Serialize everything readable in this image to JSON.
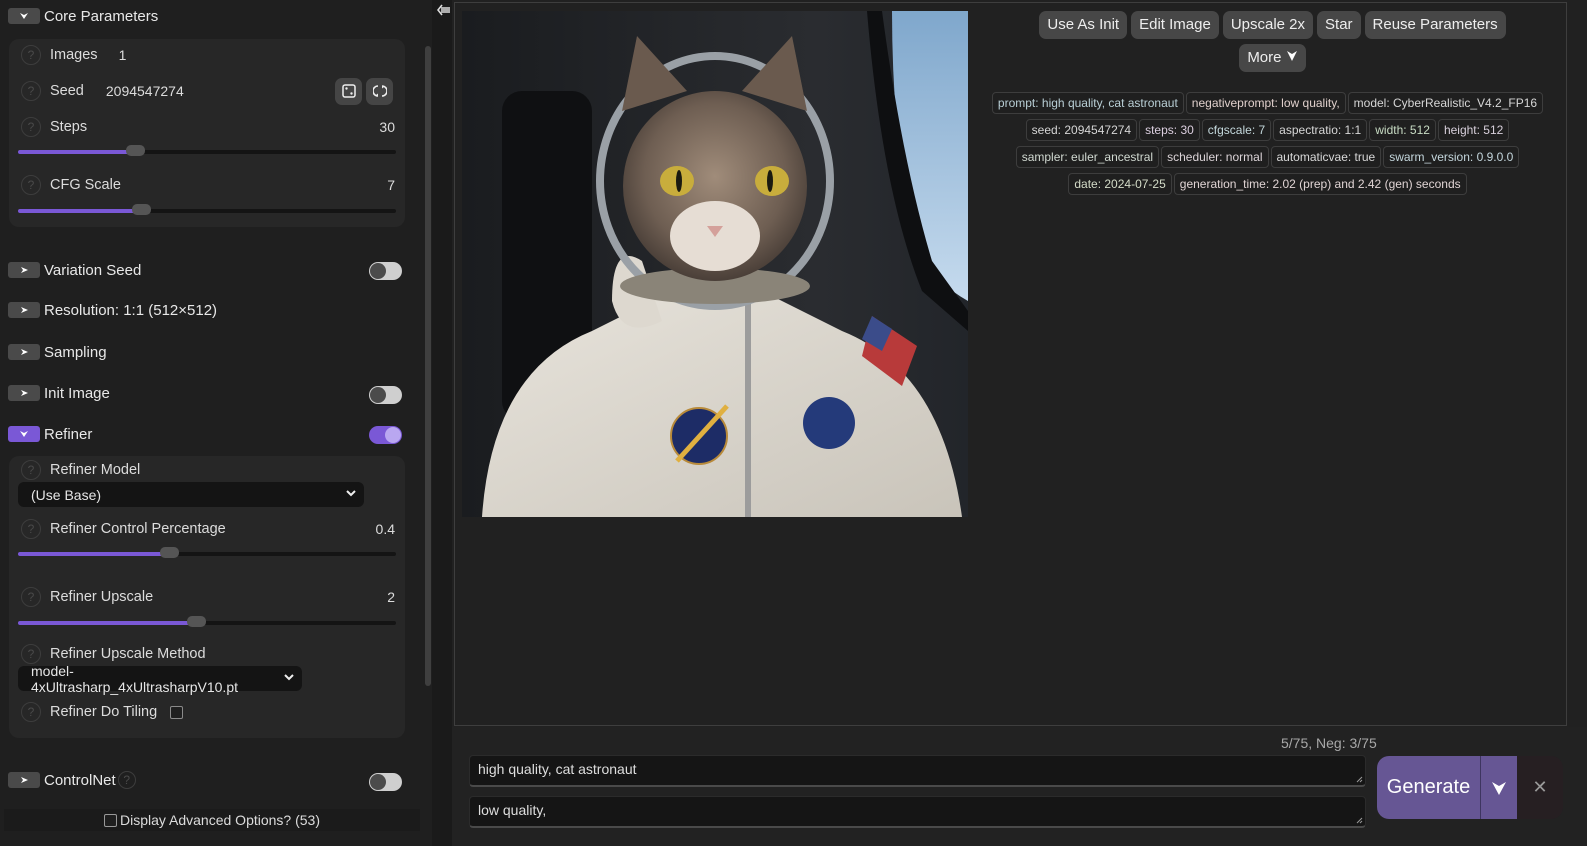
{
  "left_panel": {
    "core": {
      "title": "Core Parameters",
      "images_label": "Images",
      "images_value": "1",
      "seed_label": "Seed",
      "seed_value": "2094547274",
      "steps_label": "Steps",
      "steps_value": "30",
      "steps_fraction": 0.31,
      "cfg_label": "CFG Scale",
      "cfg_value": "7",
      "cfg_fraction": 0.325
    },
    "groups": {
      "variation_seed": {
        "title": "Variation Seed",
        "enabled": false
      },
      "resolution": {
        "title": "Resolution: 1:1 (512×512)"
      },
      "sampling": {
        "title": "Sampling"
      },
      "init_image": {
        "title": "Init Image",
        "enabled": false
      },
      "refiner": {
        "title": "Refiner",
        "enabled": true
      },
      "controlnet": {
        "title": "ControlNet",
        "enabled": false
      }
    },
    "refiner": {
      "model_label": "Refiner Model",
      "model_value": "(Use Base)",
      "control_label": "Refiner Control Percentage",
      "control_value": "0.4",
      "control_fraction": 0.4,
      "upscale_label": "Refiner Upscale",
      "upscale_value": "2",
      "upscale_fraction": 0.47,
      "method_label": "Refiner Upscale Method",
      "method_value": "model-4xUltrasharp_4xUltrasharpV10.pt",
      "tiling_label": "Refiner Do Tiling",
      "tiling_checked": false
    },
    "help_glyph": "?",
    "advanced_label": "Display Advanced Options? (53)"
  },
  "actions": [
    "Use As Init",
    "Edit Image",
    "Upscale 2x",
    "Star",
    "Reuse Parameters"
  ],
  "more_label": "More",
  "metadata": [
    {
      "k": "prompt",
      "v": "high quality, cat astronaut",
      "c": "#b9cfd6"
    },
    {
      "k": "negativeprompt",
      "v": "low quality,",
      "c": "#e0d0cc"
    },
    {
      "k": "model",
      "v": "CyberRealistic_V4.2_FP16",
      "c": "#d6d6d6"
    },
    {
      "k": "seed",
      "v": "2094547274",
      "c": "#d6d6d6"
    },
    {
      "k": "steps",
      "v": "30",
      "c": "#dccfe0"
    },
    {
      "k": "cfgscale",
      "v": "7",
      "c": "#c4d8dc"
    },
    {
      "k": "aspectratio",
      "v": "1:1",
      "c": "#d6d6d6"
    },
    {
      "k": "width",
      "v": "512",
      "c": "#c8dcc4"
    },
    {
      "k": "height",
      "v": "512",
      "c": "#d8d0dc"
    },
    {
      "k": "sampler",
      "v": "euler_ancestral",
      "c": "#d0d8d0"
    },
    {
      "k": "scheduler",
      "v": "normal",
      "c": "#dcd4d8"
    },
    {
      "k": "automaticvae",
      "v": "true",
      "c": "#d8d8d8"
    },
    {
      "k": "swarm_version",
      "v": "0.9.0.0",
      "c": "#c4d6dc"
    },
    {
      "k": "date",
      "v": "2024-07-25",
      "c": "#d4dcc8"
    },
    {
      "k": "generation_time",
      "v": "2.02 (prep) and 2.42 (gen) seconds",
      "c": "#e0d4d4"
    }
  ],
  "bottom": {
    "token_count": "5/75, Neg: 3/75",
    "prompt": "high quality, cat astronaut",
    "negative_prompt": "low quality,",
    "generate_label": "Generate",
    "cancel_glyph": "✕"
  },
  "colors": {
    "accent": "#7a58d6",
    "generate": "#665694"
  }
}
